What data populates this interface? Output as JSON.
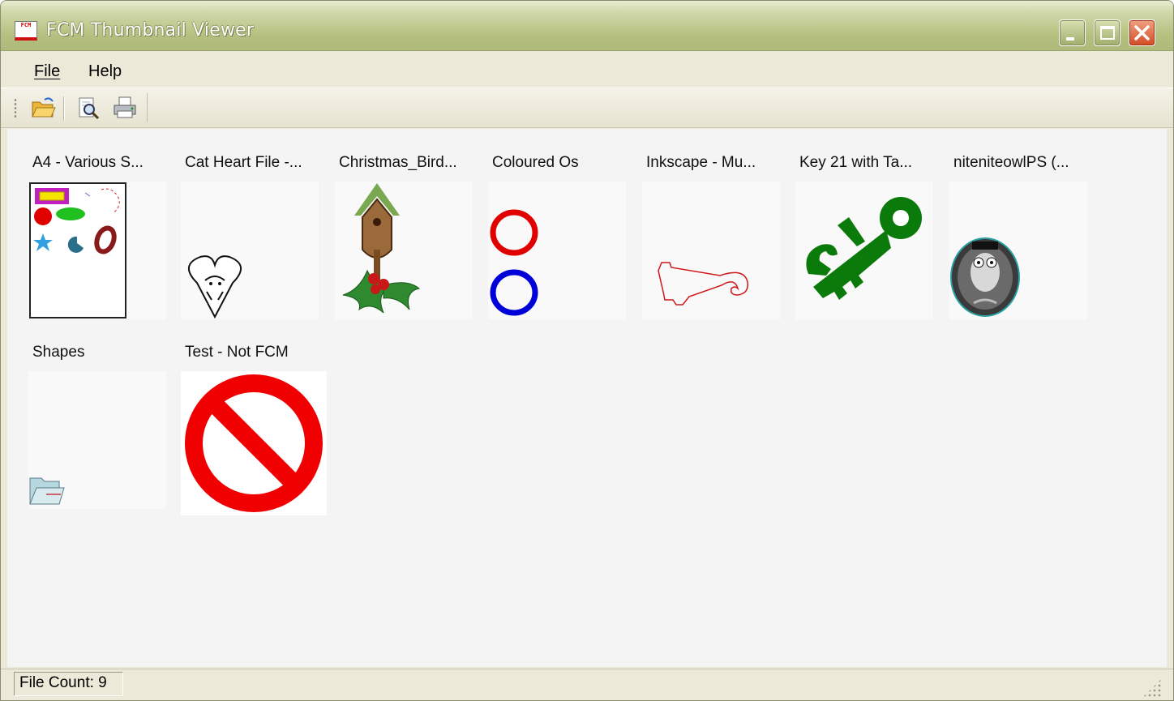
{
  "window": {
    "title": "FCM Thumbnail Viewer",
    "icon_text": "FCM"
  },
  "menu": {
    "file": "File",
    "help": "Help"
  },
  "toolbar": {
    "buttons": [
      {
        "icon": "open-folder-icon"
      },
      {
        "icon": "print-preview-icon"
      },
      {
        "icon": "print-icon"
      }
    ]
  },
  "thumbnails": [
    {
      "label": "A4 - Various S...",
      "icon": "shapes-sheet-icon"
    },
    {
      "label": "Cat Heart File -...",
      "icon": "cat-heart-icon"
    },
    {
      "label": "Christmas_Bird...",
      "icon": "birdhouse-holly-icon"
    },
    {
      "label": "Coloured Os",
      "icon": "coloured-circles-icon"
    },
    {
      "label": "Inkscape - Mu...",
      "icon": "inkscape-outline-icon"
    },
    {
      "label": "Key 21 with Ta...",
      "icon": "key-21-icon"
    },
    {
      "label": "niteniteowlPS (...",
      "icon": "owl-badge-icon"
    },
    {
      "label": "Shapes",
      "icon": "folder-icon"
    },
    {
      "label": "Test - Not FCM",
      "icon": "prohibited-icon"
    }
  ],
  "status": {
    "file_count": "File Count: 9"
  },
  "colors": {
    "title_bar": "#b5c080",
    "window_bg": "#ECE9D8",
    "content_bg": "#F4F4F4",
    "close_button": "#d24b25"
  }
}
